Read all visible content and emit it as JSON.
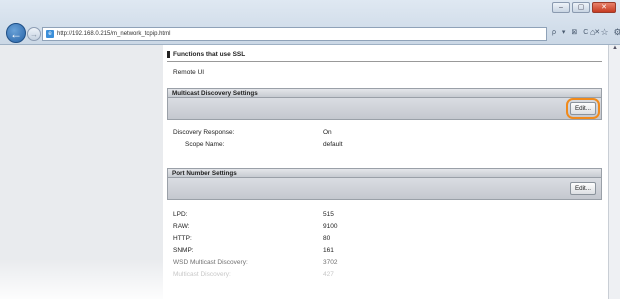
{
  "browser": {
    "url": "http://192.168.0.215/m_network_tcpip.html",
    "window_controls": [
      "–",
      "▢",
      "✕"
    ],
    "address_tools": "ρ ▾ ⊠ C ✕",
    "toolbar_icons": [
      "home-icon",
      "star-icon",
      "gear-icon"
    ]
  },
  "page": {
    "ssl_heading": "Functions that use SSL",
    "ssl_item": "Remote UI",
    "multicast": {
      "title": "Multicast Discovery Settings",
      "edit_label": "Edit...",
      "rows": [
        {
          "label": "Discovery Response:",
          "value": "On"
        },
        {
          "label": "Scope Name:",
          "value": "default"
        }
      ]
    },
    "ports": {
      "title": "Port Number Settings",
      "edit_label": "Edit...",
      "rows": [
        {
          "label": "LPD:",
          "value": "515"
        },
        {
          "label": "RAW:",
          "value": "9100"
        },
        {
          "label": "HTTP:",
          "value": "80"
        },
        {
          "label": "SNMP:",
          "value": "161"
        },
        {
          "label": "WSD Multicast Discovery:",
          "value": "3702"
        },
        {
          "label": "Multicast Discovery:",
          "value": "427"
        }
      ]
    }
  },
  "colors": {
    "highlight": "#f08a1c",
    "left_pane": "#e9ebee"
  }
}
